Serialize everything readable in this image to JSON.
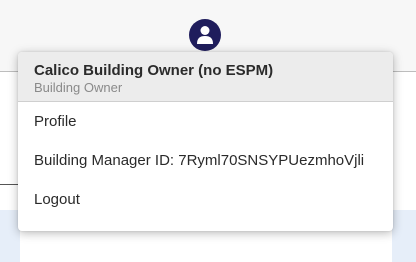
{
  "header": {
    "avatar_icon": "user-icon",
    "avatar_color": "#1f1d5c"
  },
  "user_menu": {
    "name": "Calico Building Owner (no ESPM)",
    "role": "Building Owner",
    "items": [
      {
        "label": "Profile"
      },
      {
        "label": "Building Manager ID: 7Ryml70SNSYPUezmhoVjli"
      },
      {
        "label": "Logout"
      }
    ]
  }
}
